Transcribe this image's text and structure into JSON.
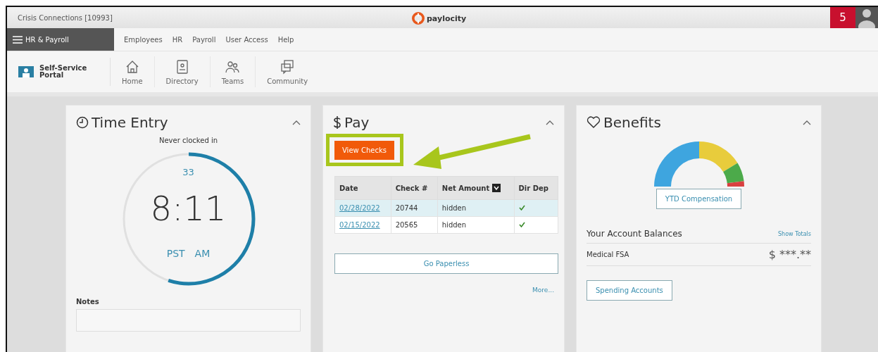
{
  "title_bar": {
    "company": "Crisis Connections [10993]",
    "logo_text": "paylocity",
    "notification_count": "5"
  },
  "menu": {
    "app_button": "HR & Payroll",
    "items": [
      "Employees",
      "HR",
      "Payroll",
      "User Access",
      "Help"
    ]
  },
  "toolbar": {
    "portal": "Self-Service Portal",
    "items": [
      {
        "kind": "home",
        "label": "Home"
      },
      {
        "kind": "directory",
        "label": "Directory"
      },
      {
        "kind": "teams",
        "label": "Teams"
      },
      {
        "kind": "community",
        "label": "Community"
      }
    ]
  },
  "time_entry": {
    "title": "Time Entry",
    "status": "Never clocked in",
    "seconds": "33",
    "time": "8:11",
    "timezone": "PST",
    "period": "AM",
    "level": 0.55,
    "notes_label": "Notes"
  },
  "pay": {
    "title": "Pay",
    "view_checks": "View Checks",
    "columns": [
      "Date",
      "Check #",
      "Net Amount",
      "Dir Dep"
    ],
    "rows": [
      {
        "date": "02/28/2022",
        "check": "20744",
        "net": "hidden",
        "direct_deposit": true,
        "selected": true
      },
      {
        "date": "02/15/2022",
        "check": "20565",
        "net": "hidden",
        "direct_deposit": true,
        "selected": false
      }
    ],
    "paperless": "Go Paperless",
    "more": "More..."
  },
  "benefits": {
    "title": "Benefits",
    "ytd": "YTD Compensation",
    "balances_title": "Your Account Balances",
    "show_totals": "Show Totals",
    "accounts": [
      {
        "name": "Medical FSA",
        "amount": "$ ***.**"
      }
    ],
    "spending": "Spending Accounts"
  }
}
